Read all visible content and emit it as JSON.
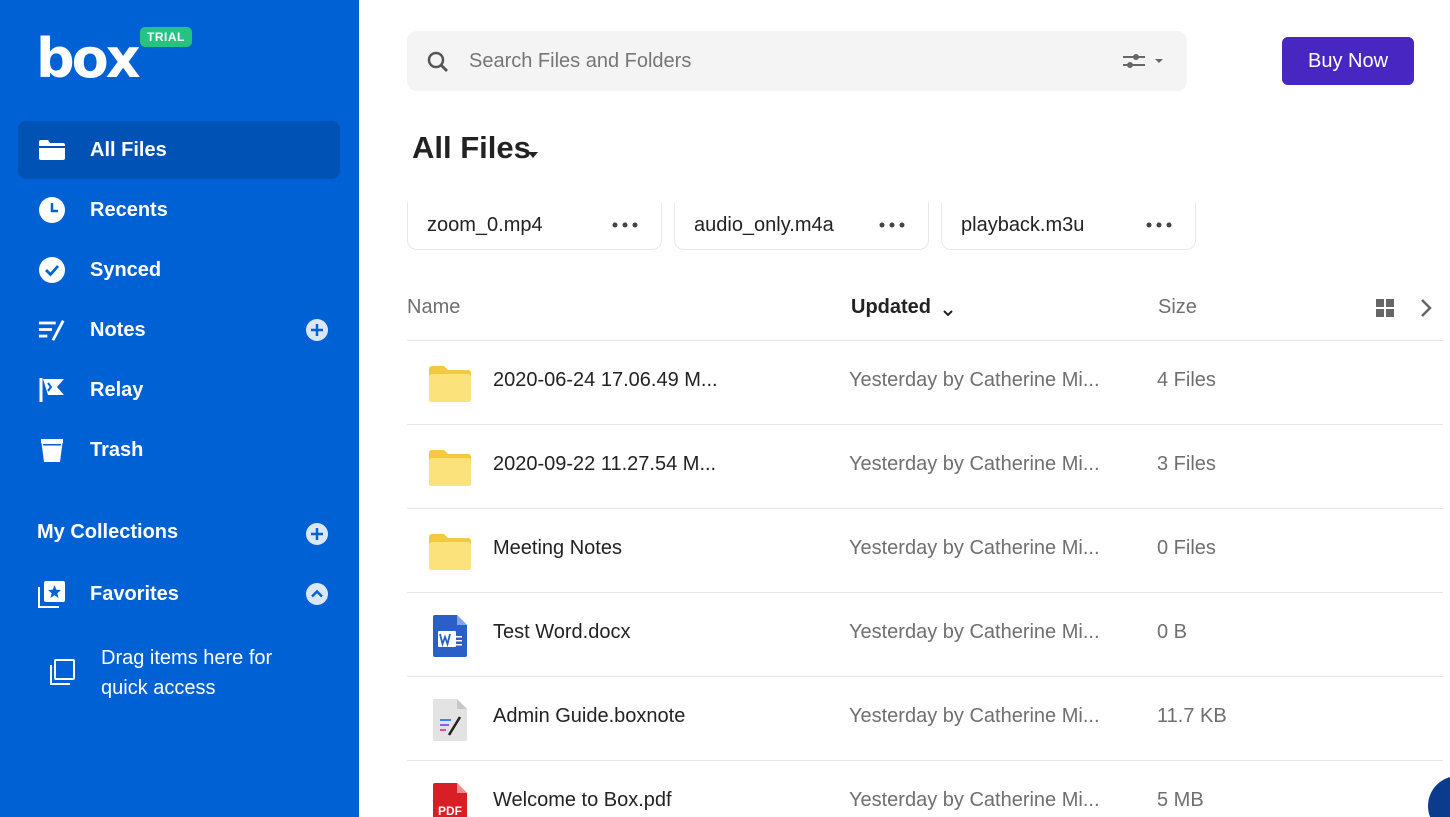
{
  "brand": {
    "logo": "box",
    "badge": "TRIAL"
  },
  "sidebar": {
    "items": [
      {
        "label": "All Files",
        "icon": "folder-icon",
        "active": true
      },
      {
        "label": "Recents",
        "icon": "clock-icon"
      },
      {
        "label": "Synced",
        "icon": "check-circle-icon"
      },
      {
        "label": "Notes",
        "icon": "notes-icon",
        "has_add": true
      },
      {
        "label": "Relay",
        "icon": "relay-flag-icon"
      },
      {
        "label": "Trash",
        "icon": "trash-icon"
      }
    ],
    "collections_label": "My Collections",
    "favorites_label": "Favorites",
    "drag_hint": "Drag items here for quick access"
  },
  "search": {
    "placeholder": "Search Files and Folders"
  },
  "header": {
    "buy_label": "Buy Now",
    "title": "All Files"
  },
  "recents": [
    {
      "name": "zoom_0.mp4"
    },
    {
      "name": "audio_only.m4a"
    },
    {
      "name": "playback.m3u"
    }
  ],
  "table": {
    "columns": {
      "name": "Name",
      "updated": "Updated",
      "size": "Size"
    },
    "rows": [
      {
        "name": "2020-06-24 17.06.49 M...",
        "updated": "Yesterday by Catherine Mi...",
        "size": "4 Files",
        "type": "folder"
      },
      {
        "name": "2020-09-22 11.27.54 M...",
        "updated": "Yesterday by Catherine Mi...",
        "size": "3 Files",
        "type": "folder"
      },
      {
        "name": "Meeting Notes",
        "updated": "Yesterday by Catherine Mi...",
        "size": "0 Files",
        "type": "folder"
      },
      {
        "name": "Test Word.docx",
        "updated": "Yesterday by Catherine Mi...",
        "size": "0 B",
        "type": "word"
      },
      {
        "name": "Admin Guide.boxnote",
        "updated": "Yesterday by Catherine Mi...",
        "size": "11.7 KB",
        "type": "boxnote"
      },
      {
        "name": "Welcome to Box.pdf",
        "updated": "Yesterday by Catherine Mi...",
        "size": "5 MB",
        "type": "pdf"
      }
    ]
  },
  "icons": {
    "pdf_label": "PDF"
  },
  "colors": {
    "sidebar": "#0061d5",
    "active_item": "#0052b4",
    "buy_button": "#4826c2",
    "trial_badge": "#26c281",
    "folder": "#fcd34d"
  }
}
